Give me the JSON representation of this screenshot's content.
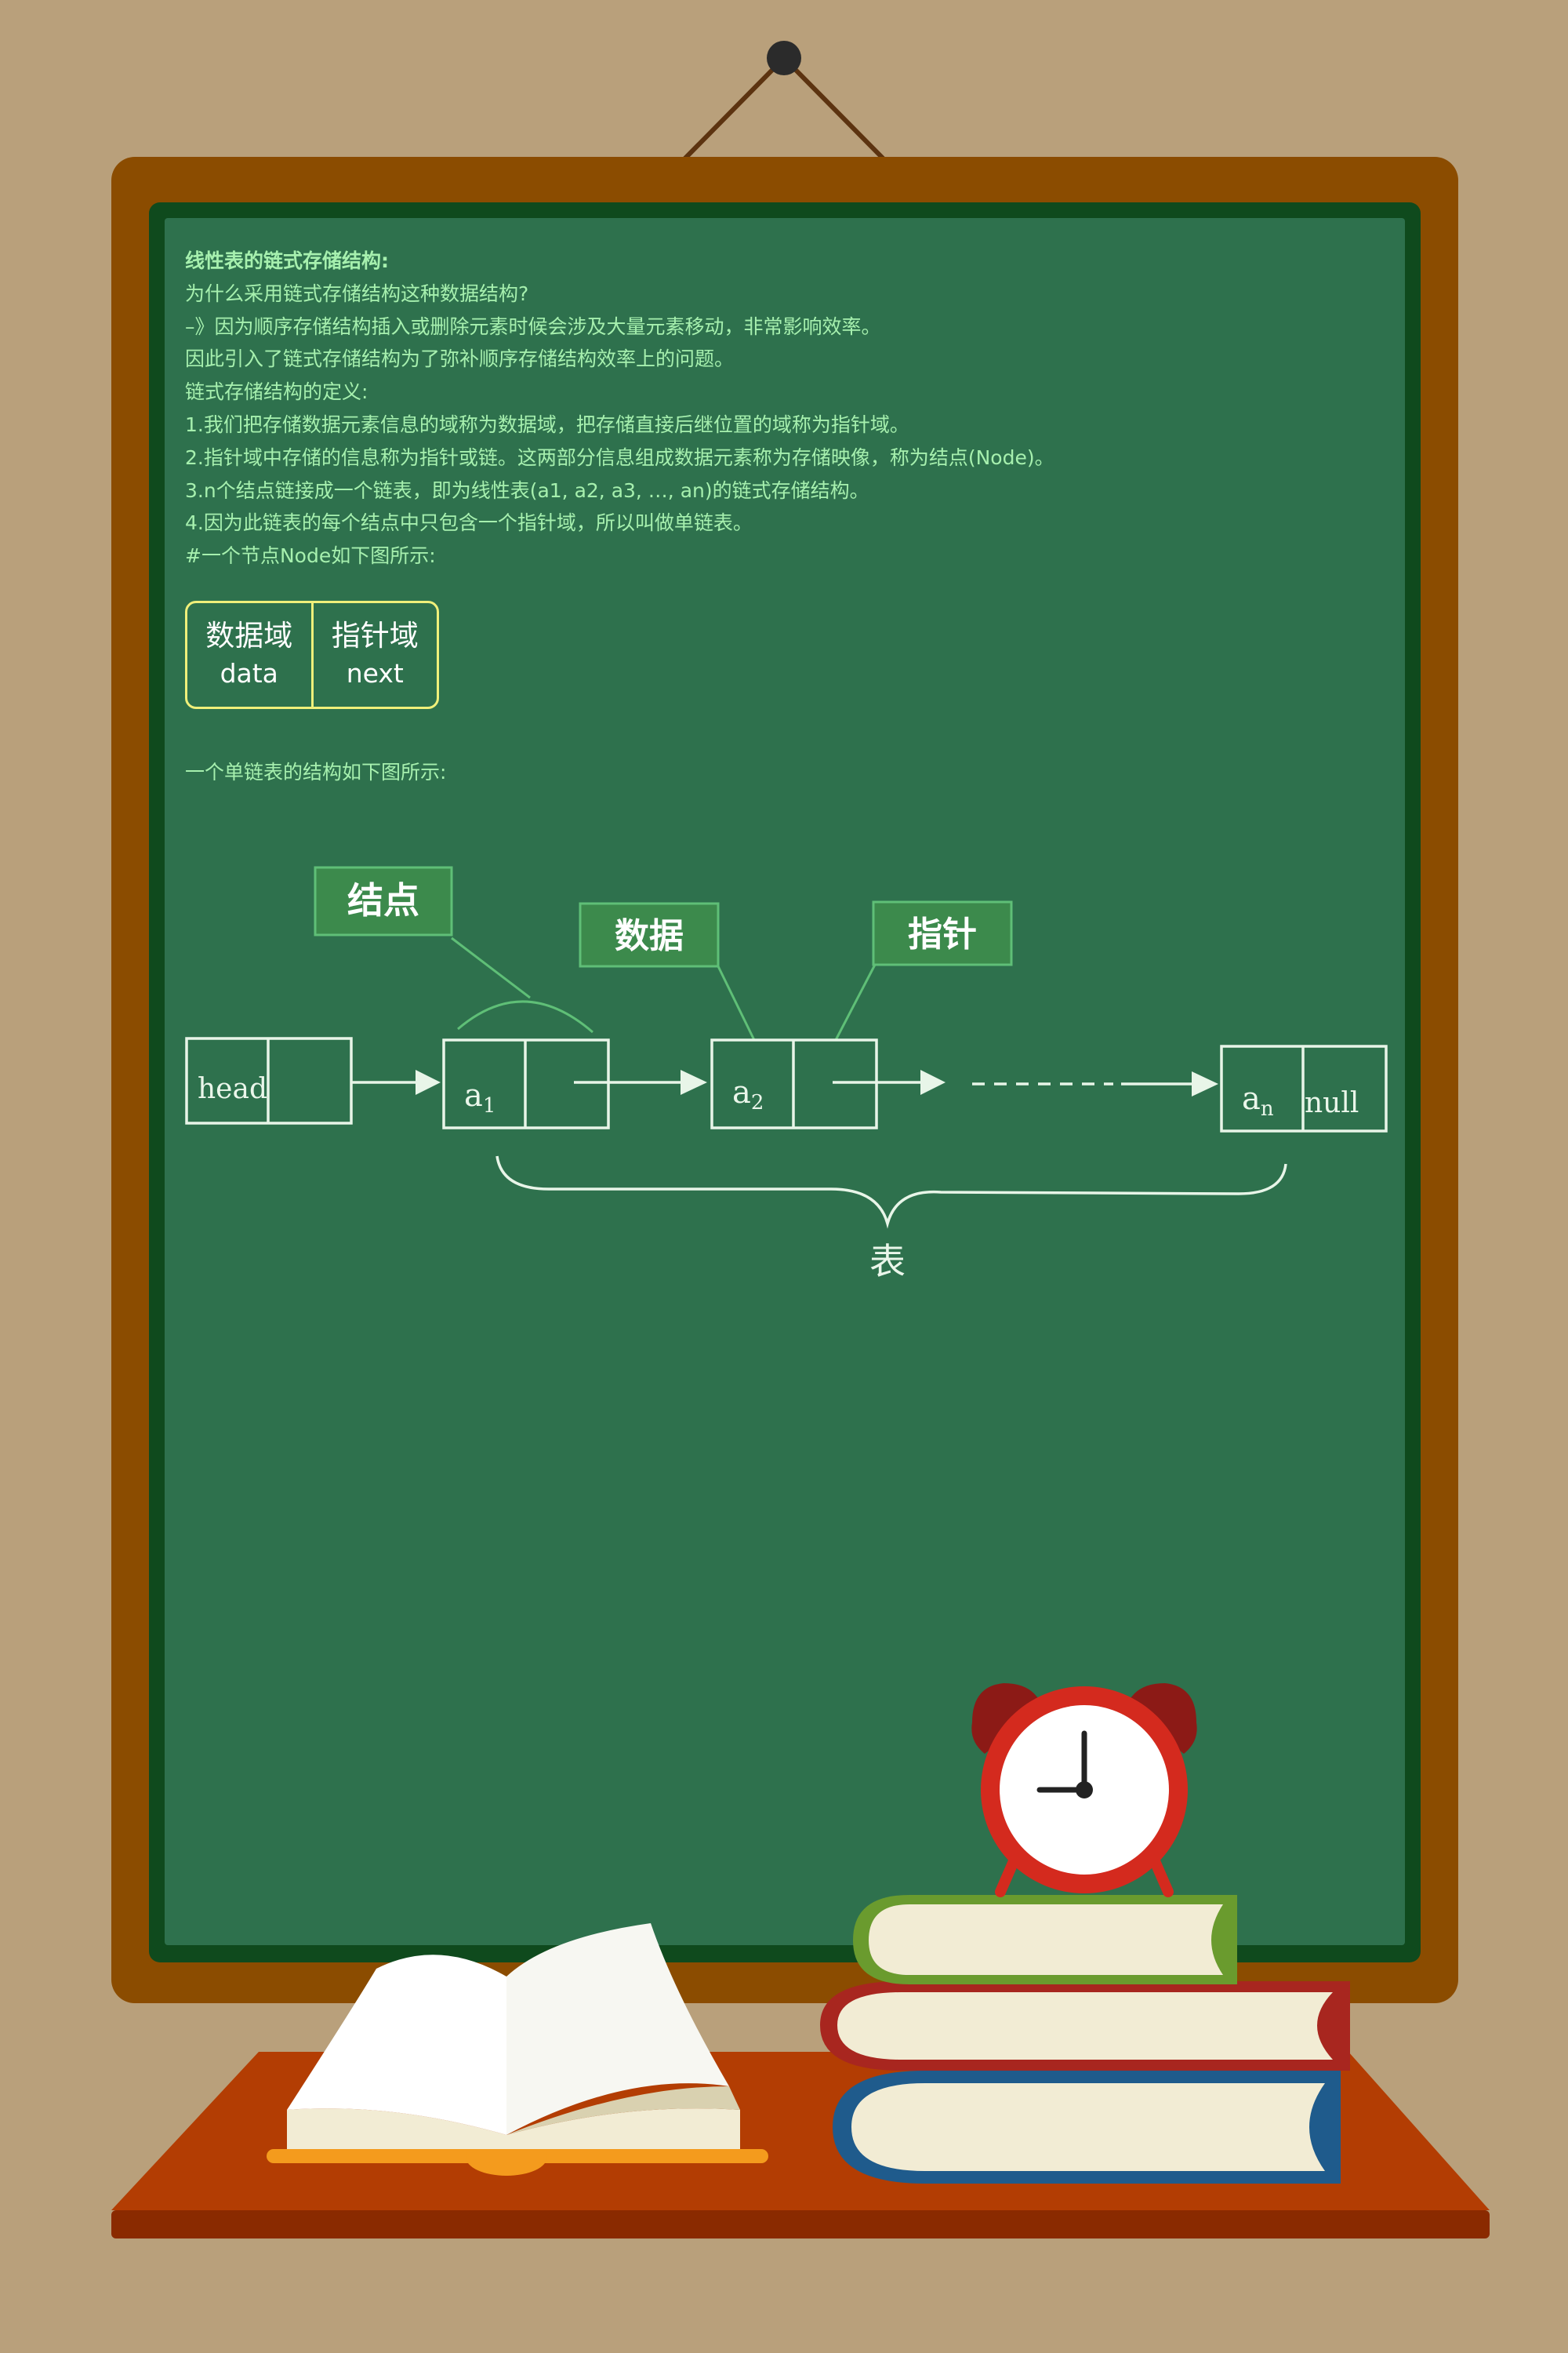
{
  "board": {
    "lines": [
      "线性表的链式存储结构:",
      "为什么采用链式存储结构这种数据结构?",
      "–》因为顺序存储结构插入或删除元素时候会涉及大量元素移动，非常影响效率。",
      "因此引入了链式存储结构为了弥补顺序存储结构效率上的问题。",
      "链式存储结构的定义:",
      "1.我们把存储数据元素信息的域称为数据域，把存储直接后继位置的域称为指针域。",
      "2.指针域中存储的信息称为指针或链。这两部分信息组成数据元素称为存储映像，称为结点(Node)。",
      "3.n个结点链接成一个链表，即为线性表(a1, a2, a3, …, an)的链式存储结构。",
      "4.因为此链表的每个结点中只包含一个指针域，所以叫做单链表。",
      "#一个节点Node如下图所示:"
    ],
    "node_def": {
      "data_label": "数据域",
      "data_sub": "data",
      "next_label": "指针域",
      "next_sub": "next"
    },
    "caption2": "一个单链表的结构如下图所示:"
  },
  "diagram": {
    "tag_node": "结点",
    "tag_data": "数据",
    "tag_pointer": "指针",
    "head": "head",
    "a1": "a",
    "a1_sub": "1",
    "a2": "a",
    "a2_sub": "2",
    "an": "a",
    "an_sub": "n",
    "null": "null",
    "brace_label": "表"
  },
  "clock": {
    "hour": 9,
    "minute": 0
  },
  "colors": {
    "background": "#b9a07b",
    "frame": "#8b4c00",
    "board": "#2e714d",
    "board_border": "#0f4a1d",
    "chalk_text": "#a6f0ae",
    "highlight_box": "#f0f07a",
    "desk": "#b33d03",
    "clock_red": "#d42a1e"
  }
}
